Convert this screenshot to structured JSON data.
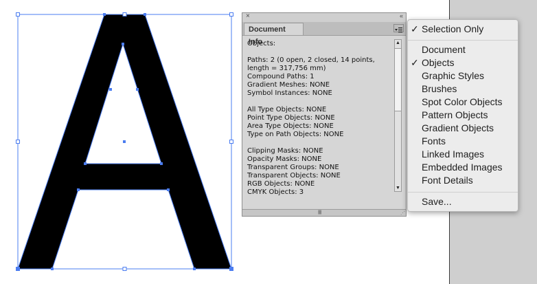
{
  "panel": {
    "close_glyph": "×",
    "collapse_glyph": "«",
    "tab_label": "Document Info",
    "info_lines": [
      "Objects:",
      "",
      "Paths: 2 (0 open, 2 closed, 14 points,",
      "length = 317,756 mm)",
      "Compound Paths: 1",
      "Gradient Meshes: NONE",
      "Symbol Instances: NONE",
      "",
      "All Type Objects: NONE",
      "Point Type Objects: NONE",
      "Area Type Objects: NONE",
      "Type on Path Objects: NONE",
      "",
      "Clipping Masks: NONE",
      "Opacity Masks: NONE",
      "Transparent Groups: NONE",
      "Transparent Objects: NONE",
      "RGB Objects: NONE",
      "CMYK Objects: 3"
    ]
  },
  "menu": {
    "check_glyph": "✓",
    "items": [
      {
        "label": "Selection Only",
        "checked": true
      },
      {
        "label": "Document",
        "checked": false
      },
      {
        "label": "Objects",
        "checked": true
      },
      {
        "label": "Graphic Styles",
        "checked": false
      },
      {
        "label": "Brushes",
        "checked": false
      },
      {
        "label": "Spot Color Objects",
        "checked": false
      },
      {
        "label": "Pattern Objects",
        "checked": false
      },
      {
        "label": "Gradient Objects",
        "checked": false
      },
      {
        "label": "Fonts",
        "checked": false
      },
      {
        "label": "Linked Images",
        "checked": false
      },
      {
        "label": "Embedded Images",
        "checked": false
      },
      {
        "label": "Font Details",
        "checked": false
      },
      {
        "label": "Save...",
        "checked": false
      }
    ]
  },
  "colors": {
    "selection": "#4a7cf0",
    "artwork_fill": "#000000"
  }
}
